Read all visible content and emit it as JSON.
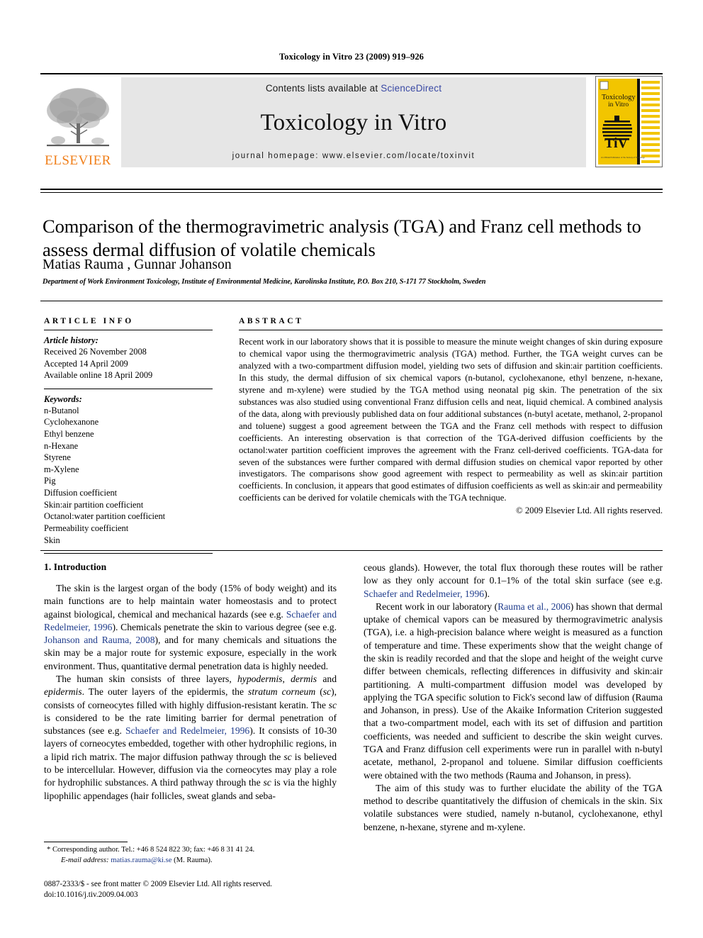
{
  "running_head": "Toxicology in Vitro 23 (2009) 919–926",
  "masthead": {
    "publisher_name": "ELSEVIER",
    "contents_prefix": "Contents lists available at ",
    "sciencedirect": "ScienceDirect",
    "journal_name": "Toxicology in Vitro",
    "homepage": "journal homepage: www.elsevier.com/locate/toxinvit",
    "cover": {
      "line1": "Toxicology",
      "line2": "in Vitro",
      "logo_text": "TiV",
      "footer_text": "An Official Publication of the Society of Toxicology"
    }
  },
  "article": {
    "title": "Comparison of the thermogravimetric analysis (TGA) and Franz cell methods to assess dermal diffusion of volatile chemicals",
    "authors": "Matias Rauma , Gunnar Johanson",
    "author_marker": "*",
    "affiliation": "Department of Work Environment Toxicology, Institute of Environmental Medicine, Karolinska Institute, P.O. Box 210, S-171 77 Stockholm, Sweden"
  },
  "info": {
    "heading": "ARTICLE INFO",
    "history_label": "Article history:",
    "history": [
      "Received 26 November 2008",
      "Accepted 14 April 2009",
      "Available online 18 April 2009"
    ],
    "keywords_label": "Keywords:",
    "keywords": [
      "n-Butanol",
      "Cyclohexanone",
      "Ethyl benzene",
      "n-Hexane",
      "Styrene",
      "m-Xylene",
      "Pig",
      "Diffusion coefficient",
      "Skin:air partition coefficient",
      "Octanol:water partition coefficient",
      "Permeability coefficient",
      "Skin"
    ]
  },
  "abstract": {
    "heading": "ABSTRACT",
    "text": "Recent work in our laboratory shows that it is possible to measure the minute weight changes of skin during exposure to chemical vapor using the thermogravimetric analysis (TGA) method. Further, the TGA weight curves can be analyzed with a two-compartment diffusion model, yielding two sets of diffusion and skin:air partition coefficients. In this study, the dermal diffusion of six chemical vapors (n-butanol, cyclohexanone, ethyl benzene, n-hexane, styrene and m-xylene) were studied by the TGA method using neonatal pig skin. The penetration of the six substances was also studied using conventional Franz diffusion cells and neat, liquid chemical. A combined analysis of the data, along with previously published data on four additional substances (n-butyl acetate, methanol, 2-propanol and toluene) suggest a good agreement between the TGA and the Franz cell methods with respect to diffusion coefficients. An interesting observation is that correction of the TGA-derived diffusion coefficients by the octanol:water partition coefficient improves the agreement with the Franz cell-derived coefficients. TGA-data for seven of the substances were further compared with dermal diffusion studies on chemical vapor reported by other investigators. The comparisons show good agreement with respect to permeability as well as skin:air partition coefficients. In conclusion, it appears that good estimates of diffusion coefficients as well as skin:air and permeability coefficients can be derived for volatile chemicals with the TGA technique.",
    "copyright": "© 2009 Elsevier Ltd. All rights reserved."
  },
  "body": {
    "section_heading": "1. Introduction",
    "left_paragraphs": [
      "The skin is the largest organ of the body (15% of body weight) and its main functions are to help maintain water homeostasis and to protect against biological, chemical and mechanical hazards (see e.g. Schaefer and Redelmeier, 1996). Chemicals penetrate the skin to various degree (see e.g. Johanson and Rauma, 2008), and for many chemicals and situations the skin may be a major route for systemic exposure, especially in the work environment. Thus, quantitative dermal penetration data is highly needed.",
      "The human skin consists of three layers, hypodermis, dermis and epidermis. The outer layers of the epidermis, the stratum corneum (sc), consists of corneocytes filled with highly diffusion-resistant keratin. The sc is considered to be the rate limiting barrier for dermal penetration of substances (see e.g. Schaefer and Redelmeier, 1996). It consists of 10-30 layers of corneocytes embedded, together with other hydrophilic regions, in a lipid rich matrix. The major diffusion pathway through the sc is believed to be intercellular. However, diffusion via the corneocytes may play a role for hydrophilic substances. A third pathway through the sc is via the highly lipophilic appendages (hair follicles, sweat glands and seba-"
    ],
    "right_paragraphs": [
      "ceous glands). However, the total flux thorough these routes will be rather low as they only account for 0.1–1% of the total skin surface (see e.g. Schaefer and Redelmeier, 1996).",
      "Recent work in our laboratory (Rauma et al., 2006) has shown that dermal uptake of chemical vapors can be measured by thermogravimetric analysis (TGA), i.e. a high-precision balance where weight is measured as a function of temperature and time. These experiments show that the weight change of the skin is readily recorded and that the slope and height of the weight curve differ between chemicals, reflecting differences in diffusivity and skin:air partitioning. A multi-compartment diffusion model was developed by applying the TGA specific solution to Fick's second law of diffusion (Rauma and Johanson, in press). Use of the Akaike Information Criterion suggested that a two-compartment model, each with its set of diffusion and partition coefficients, was needed and sufficient to describe the skin weight curves. TGA and Franz diffusion cell experiments were run in parallel with n-butyl acetate, methanol, 2-propanol and toluene. Similar diffusion coefficients were obtained with the two methods (Rauma and Johanson, in press).",
      "The aim of this study was to further elucidate the ability of the TGA method to describe quantitatively the diffusion of chemicals in the skin. Six volatile substances were studied, namely n-butanol, cyclohexanone, ethyl benzene, n-hexane, styrene and m-xylene."
    ],
    "citations": [
      "Schaefer and Redelmeier, 1996",
      "Johanson and Rauma, 2008",
      "Rauma et al., 2006"
    ]
  },
  "footnote": {
    "corresponding": "Corresponding author. Tel.: +46 8 524 822 30; fax: +46 8 31 41 24.",
    "email_label": "E-mail address:",
    "email": "matias.rauma@ki.se",
    "email_suffix": " (M. Rauma)."
  },
  "colophon": {
    "line1": "0887-2333/$ - see front matter © 2009 Elsevier Ltd. All rights reserved.",
    "line2": "doi:10.1016/j.tiv.2009.04.003"
  },
  "colors": {
    "link_blue": "#1f3c8c",
    "sciencedirect_blue": "#3a49a4",
    "elsevier_orange": "#F07F1A",
    "banner_gray": "#e6e6e6",
    "cover_yellow": "#F2C500"
  }
}
